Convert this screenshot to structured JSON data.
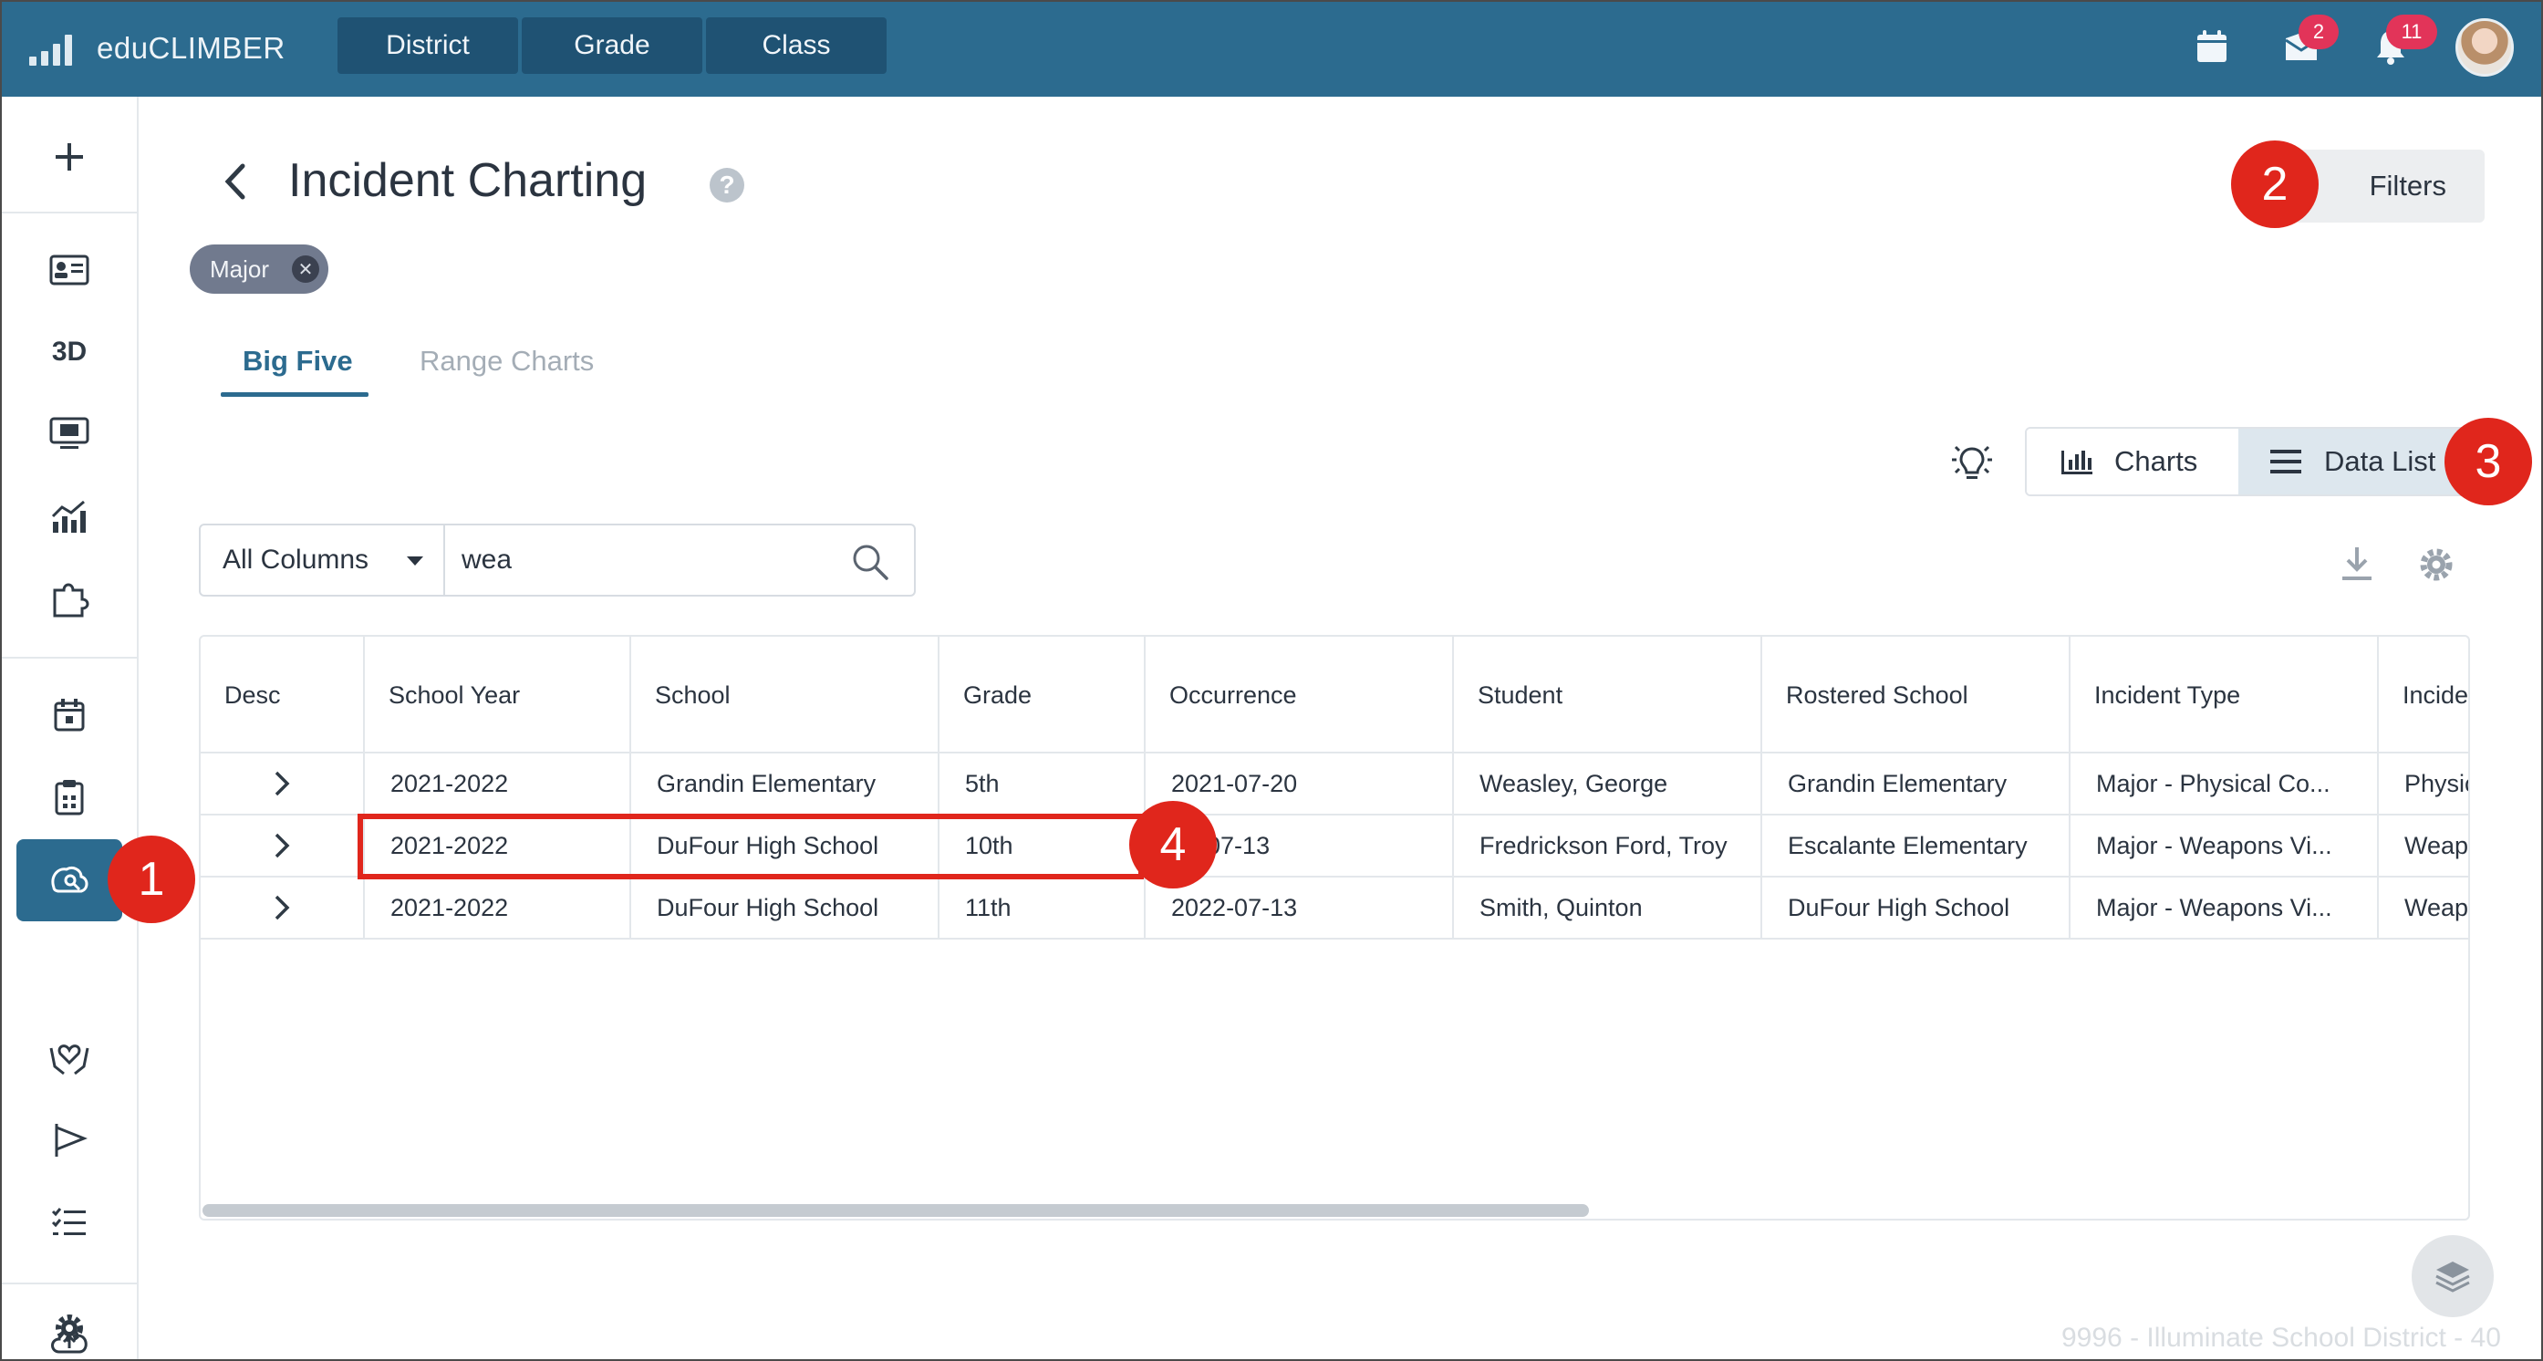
{
  "app": {
    "brand": "eduCLIMBER",
    "level_tabs": [
      "District",
      "Grade",
      "Class"
    ],
    "mail_badge": "2",
    "notification_badge": "11"
  },
  "sidebar": {
    "icons": [
      "plus-icon",
      "id-card-icon",
      "3d-icon",
      "monitor-icon",
      "chart-icon",
      "puzzle-icon",
      "calendar-icon",
      "clipboard-icon",
      "incident-icon",
      "hands-heart-icon",
      "flag-icon",
      "checklist-icon",
      "cloud-upload-icon",
      "settings-icon"
    ],
    "label_3d": "3D",
    "active": "incident-icon"
  },
  "page": {
    "title": "Incident Charting",
    "filters_label": "Filters",
    "filter_chip": "Major"
  },
  "tabs": [
    {
      "label": "Big Five",
      "active": true
    },
    {
      "label": "Range Charts",
      "active": false
    }
  ],
  "view_toggle": {
    "charts_label": "Charts",
    "data_list_label": "Data List",
    "selected": "Data List"
  },
  "search": {
    "column_select": "All Columns",
    "value": "wea"
  },
  "table": {
    "columns": [
      "Desc",
      "School Year",
      "School",
      "Grade",
      "Occurrence",
      "Student",
      "Rostered School",
      "Incident Type",
      "Incide"
    ],
    "rows": [
      [
        "2021-2022",
        "Grandin Elementary",
        "5th",
        "2021-07-20",
        "Weasley, George",
        "Grandin Elementary",
        "Major - Physical Co...",
        "Physic"
      ],
      [
        "2021-2022",
        "DuFour High School",
        "10th",
        "2​2-07-13",
        "Fredrickson Ford, Troy",
        "Escalante Elementary",
        "Major - Weapons Vi...",
        "Weap"
      ],
      [
        "2021-2022",
        "DuFour High School",
        "11th",
        "2022-07-13",
        "Smith, Quinton",
        "DuFour High School",
        "Major - Weapons Vi...",
        "Weap"
      ]
    ]
  },
  "annotations": {
    "markers": [
      "1",
      "2",
      "3",
      "4"
    ],
    "accent_color": "#e0261c"
  },
  "footer": {
    "text": "9996 - Illuminate School District - 40"
  },
  "colors": {
    "header": "#2c6b8f",
    "level_tab": "#1f5273",
    "accent": "#2c6b8f",
    "badge": "#e23459"
  }
}
